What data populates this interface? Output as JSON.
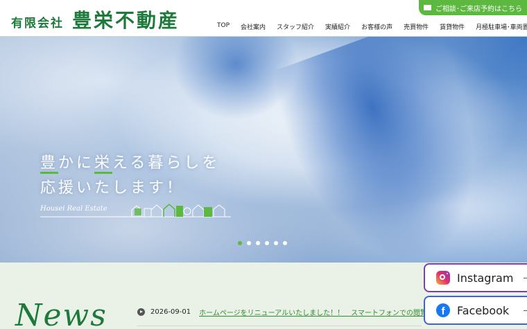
{
  "header": {
    "company_prefix": "有限会社",
    "company_name": "豊栄不動産",
    "contact_label": "ご相談･ご来店予約はこちら"
  },
  "nav": {
    "items": [
      "TOP",
      "会社案内",
      "スタッフ紹介",
      "実績紹介",
      "お客様の声",
      "売買物件",
      "賃貸物件",
      "月極駐車場･車両置場"
    ]
  },
  "hero": {
    "catch_line1_a": "豊",
    "catch_line1_b": "かに",
    "catch_line1_c": "栄",
    "catch_line1_d": "える暮らしを",
    "catch_line2": "応援いたします！",
    "script_text": "Housei Real Estate",
    "slide_count": 6,
    "active_slide": 1
  },
  "news": {
    "heading": "News",
    "items": [
      {
        "date": "2026-09-01",
        "title": "ホームページをリニューアルいたしました！！　スマートフォンでの閲覧にも対応してい"
      }
    ]
  },
  "sns": {
    "instagram_label": "Instagram",
    "facebook_label": "Facebook"
  },
  "colors": {
    "brand_green": "#1d7a3a",
    "accent_green": "#5cb83f",
    "instagram_border": "#7b3fae",
    "facebook_border": "#3a64d8"
  }
}
